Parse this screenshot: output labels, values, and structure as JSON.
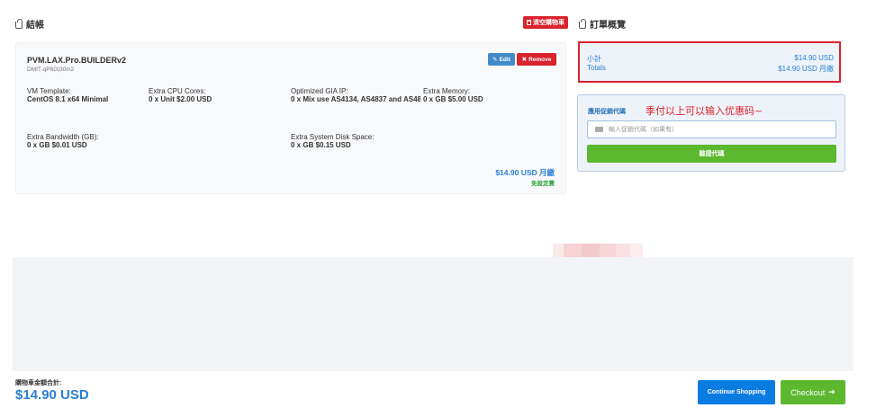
{
  "cart": {
    "title": "結帳",
    "empty_cart": "清空購物車"
  },
  "product": {
    "name": "PVM.LAX.Pro.BUILDERv2",
    "id": "DMIT-qP6G|30m2",
    "edit": "Edit",
    "remove": "Remove",
    "options": [
      {
        "label": "VM Template:",
        "value": "CentOS 8.1 x64 Minimal"
      },
      {
        "label": "Extra CPU Cores:",
        "value": "0 x Unit $2.00 USD"
      },
      {
        "label": "Optimized GIA IP:",
        "value": "0 x Mix use AS4134, AS4837 and AS48"
      },
      {
        "label": "Extra Memory:",
        "value": "0 x GB $5.00 USD"
      },
      {
        "label": "Extra Bandwidth (GB):",
        "value": "0 x GB $0.01 USD"
      },
      {
        "label": "Extra System Disk Space:",
        "value": "0 x GB $0.15 USD"
      }
    ],
    "price": "$14.90 USD 月繳",
    "setup": "免設定費"
  },
  "summary": {
    "title": "訂單概覽",
    "subtotal_label": "小計",
    "subtotal_value": "$14.90 USD",
    "totals_label": "Totals",
    "totals_value": "$14.90 USD 月繳"
  },
  "promo": {
    "title": "應用促銷代碼",
    "note": "季付以上可以输入优惠码~",
    "placeholder": "輸入促銷代碼（如果有）",
    "button": "驗證代碼"
  },
  "footer": {
    "total_label": "購物車金額合計:",
    "total_value": "$14.90 USD",
    "continue": "Continue Shopping",
    "checkout": "Checkout",
    "checkout_arrow": "➔"
  },
  "colors": {
    "accent_blue": "#2a7fd4",
    "danger_red": "#d9232d",
    "success_green": "#5cb82e"
  }
}
